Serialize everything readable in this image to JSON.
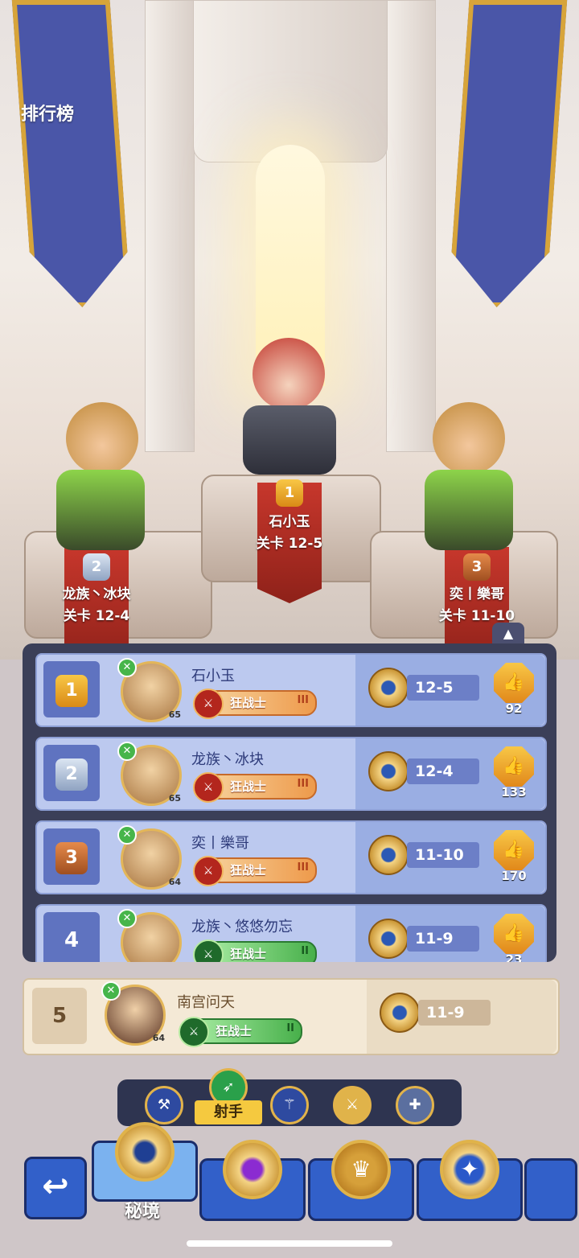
{
  "header": {
    "title": "排行榜"
  },
  "podium": [
    {
      "rank": "2",
      "name": "龙族丶冰块",
      "stage": "关卡 12-4"
    },
    {
      "rank": "1",
      "name": "石小玉",
      "stage": "关卡 12-5"
    },
    {
      "rank": "3",
      "name": "奕丨樂哥",
      "stage": "关卡 11-10"
    }
  ],
  "collapse_icon": "caret-up-icon",
  "leaderboard": [
    {
      "rank": "1",
      "name": "石小玉",
      "level": "65",
      "class": "狂战士",
      "tier": "III",
      "stage": "12-5",
      "likes": "92"
    },
    {
      "rank": "2",
      "name": "龙族丶冰块",
      "level": "65",
      "class": "狂战士",
      "tier": "III",
      "stage": "12-4",
      "likes": "133"
    },
    {
      "rank": "3",
      "name": "奕丨樂哥",
      "level": "64",
      "class": "狂战士",
      "tier": "III",
      "stage": "11-10",
      "likes": "170"
    },
    {
      "rank": "4",
      "name": "龙族丶悠悠勿忘",
      "level": "",
      "class": "狂战士",
      "tier": "II",
      "stage": "11-9",
      "likes": "23"
    }
  ],
  "me": {
    "rank": "5",
    "name": "南宫问天",
    "level": "64",
    "class": "狂战士",
    "tier": "II",
    "stage": "11-9"
  },
  "class_filters": {
    "selected_label": "射手",
    "icons": [
      "axe-icon",
      "bow-icon",
      "staff-icon",
      "dagger-icon",
      "holy-icon"
    ]
  },
  "bottom_tabs": {
    "back_icon": "back-arrow-icon",
    "active_label": "秘境",
    "icons": [
      "secret-realm-icon",
      "purple-eye-emblem-icon",
      "crown-emblem-icon",
      "star-emblem-icon"
    ]
  },
  "colors": {
    "gold": "#f8c746",
    "panel": "#3b3f58",
    "row": "#bcc9ef",
    "accent_blue": "#3260c9"
  }
}
